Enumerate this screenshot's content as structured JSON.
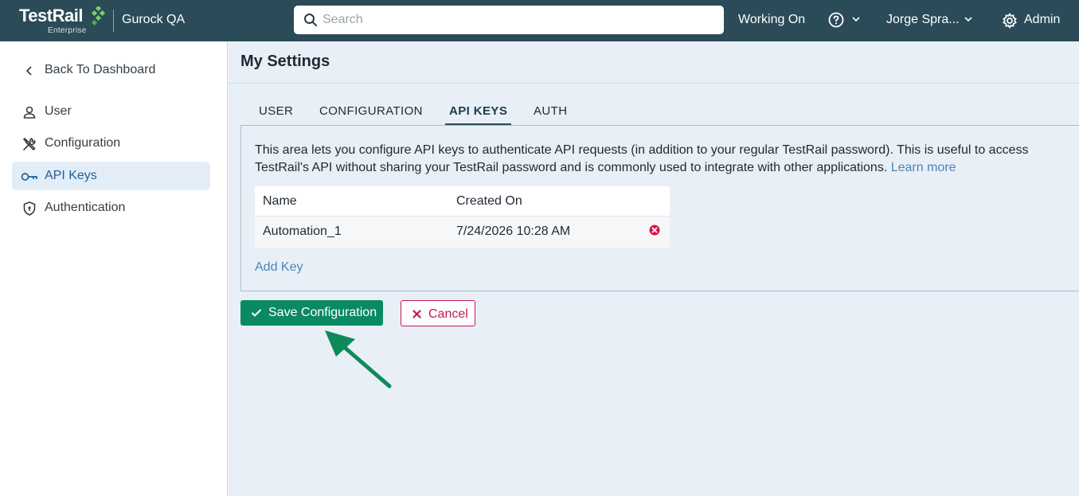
{
  "topbar": {
    "logo_text": "TestRail",
    "logo_sub": "Enterprise",
    "project": "Gurock QA",
    "search_placeholder": "Search",
    "working_on": "Working On",
    "user": "Jorge Spra...",
    "admin": "Admin"
  },
  "sidebar": {
    "items": [
      {
        "label": "Back To Dashboard",
        "icon": "chevron-left-icon"
      },
      {
        "label": "User",
        "icon": "user-icon"
      },
      {
        "label": "Configuration",
        "icon": "tools-icon"
      },
      {
        "label": "API Keys",
        "icon": "key-icon",
        "active": true
      },
      {
        "label": "Authentication",
        "icon": "shield-icon"
      }
    ]
  },
  "main": {
    "title": "My Settings",
    "tabs": [
      {
        "label": "USER"
      },
      {
        "label": "CONFIGURATION"
      },
      {
        "label": "API KEYS",
        "active": true
      },
      {
        "label": "AUTH"
      }
    ],
    "description": "This area lets you configure API keys to authenticate API requests (in addition to your regular TestRail password). This is useful to access TestRail's API without sharing your TestRail password and is commonly used to integrate with other applications.",
    "learn_more": "Learn more",
    "table": {
      "columns": [
        "Name",
        "Created On"
      ],
      "rows": [
        {
          "name": "Automation_1",
          "created_on": "7/24/2026 10:28 AM"
        }
      ]
    },
    "add_key": "Add Key",
    "save_label": "Save Configuration",
    "cancel_label": "Cancel"
  },
  "colors": {
    "topbar": "#2b4b58",
    "accent_green": "#0a8a62",
    "cancel_red": "#c2185b",
    "link_blue": "#4d86b8",
    "arrow": "#0a8a62"
  }
}
